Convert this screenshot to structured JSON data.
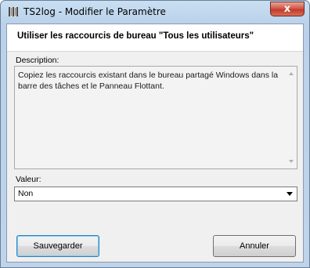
{
  "window": {
    "title": "TS2log - Modifier le Paramètre",
    "close_label": "x"
  },
  "header": {
    "title": "Utiliser les raccourcis de bureau \"Tous les utilisateurs\""
  },
  "description": {
    "label": "Description:",
    "text": "Copiez les raccourcis existant dans le bureau partagé Windows dans la barre des tâches et le Panneau Flottant."
  },
  "value": {
    "label": "Valeur:",
    "selected": "Non"
  },
  "buttons": {
    "save": "Sauvegarder",
    "cancel": "Annuler"
  }
}
